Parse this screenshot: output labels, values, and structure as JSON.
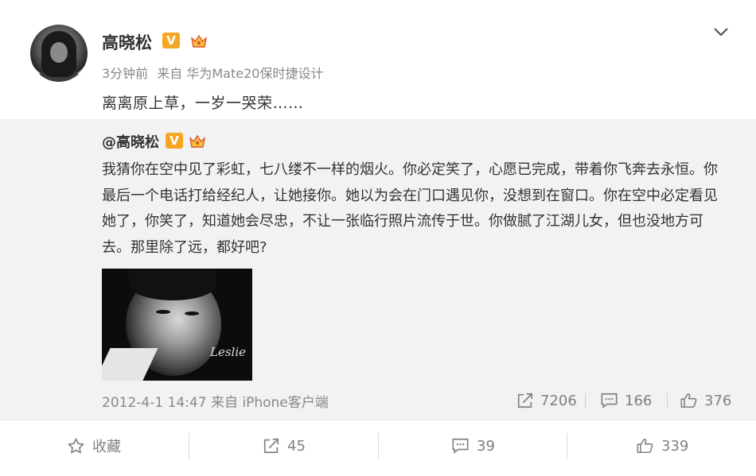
{
  "post": {
    "username": "高晓松",
    "time": "3分钟前",
    "source": "来自 华为Mate20保时捷设计",
    "text": "离离原上草，一岁一哭荣……",
    "verified_badge": "V"
  },
  "quoted": {
    "username": "@高晓松",
    "verified_badge": "V",
    "text": "我猜你在空中见了彩虹，七八缕不一样的烟火。你必定笑了，心愿已完成，带着你飞奔去永恒。你最后一个电话打给经纪人，让她接你。她以为会在门口遇见你，没想到在窗口。你在空中必定看见她了，你笑了，知道她会尽忠，不让一张临行照片流传于世。你做腻了江湖儿女，但也没地方可去。那里除了远，都好吧?",
    "photo_signature": "Leslie",
    "timestamp": "2012-4-1 14:47",
    "source": "来自 iPhone客户端",
    "reposts": "7206",
    "comments": "166",
    "likes": "376"
  },
  "actions": {
    "favorite": "收藏",
    "reposts": "45",
    "comments": "39",
    "likes": "339"
  },
  "icons": [
    "chevron-down-icon",
    "repost-icon",
    "comment-icon",
    "like-icon",
    "star-icon",
    "crown-icon"
  ],
  "colors": {
    "badge": "#f5a623",
    "quote_bg": "#f2f2f2",
    "muted_text": "#888888"
  }
}
